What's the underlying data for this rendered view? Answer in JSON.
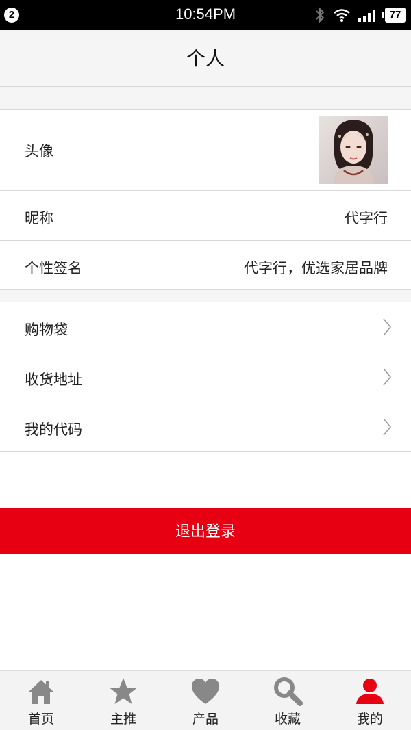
{
  "status_bar": {
    "notification_count": "2",
    "time": "10:54PM",
    "battery": "77"
  },
  "header": {
    "title": "个人"
  },
  "profile": {
    "avatar_label": "头像",
    "nickname_label": "昵称",
    "nickname_value": "代字行",
    "signature_label": "个性签名",
    "signature_value": "代字行，优选家居品牌"
  },
  "menu": {
    "items": [
      {
        "label": "购物袋"
      },
      {
        "label": "收货地址"
      },
      {
        "label": "我的代码"
      }
    ]
  },
  "logout_label": "退出登录",
  "tabbar": {
    "items": [
      {
        "label": "首页",
        "icon": "home-icon"
      },
      {
        "label": "主推",
        "icon": "star-icon"
      },
      {
        "label": "产品",
        "icon": "heart-icon"
      },
      {
        "label": "收藏",
        "icon": "search-icon"
      },
      {
        "label": "我的",
        "icon": "user-icon"
      }
    ],
    "active_index": 4,
    "active_color": "#e60012",
    "inactive_color": "#888888"
  },
  "colors": {
    "accent": "#e60012"
  }
}
